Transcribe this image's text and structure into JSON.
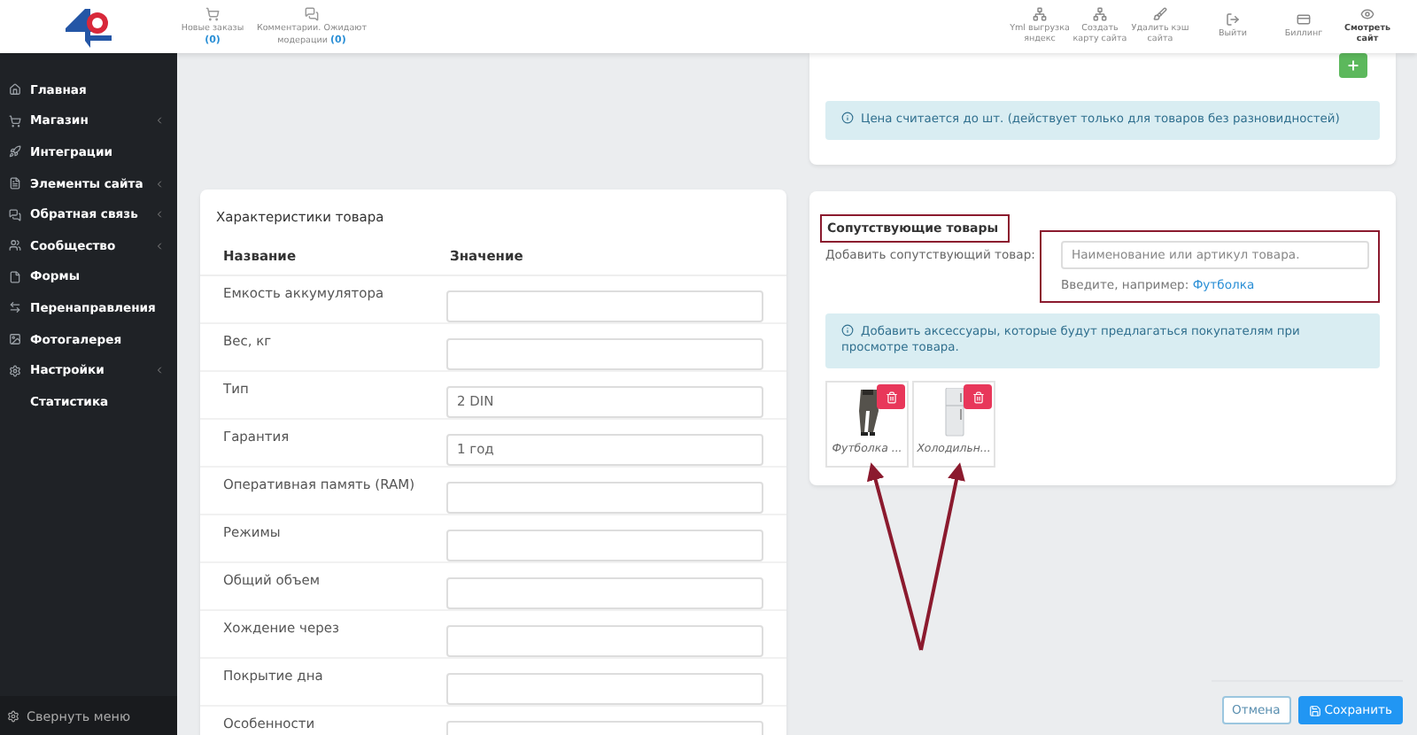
{
  "header": {
    "left_items": [
      {
        "label": "Новые заказы",
        "count": "(0)"
      },
      {
        "label": "Комментарии. Ожидают модерации",
        "count": "(0)"
      }
    ],
    "right_items": [
      {
        "label": "Yml выгрузка яндекс"
      },
      {
        "label": "Создать карту сайта"
      },
      {
        "label": "Удалить кэш сайта"
      },
      {
        "label": "Выйти"
      },
      {
        "label": "Биллинг"
      },
      {
        "label": "Смотреть сайт"
      }
    ]
  },
  "sidebar": {
    "items": [
      {
        "label": "Главная",
        "expandable": false
      },
      {
        "label": "Магазин",
        "expandable": true
      },
      {
        "label": "Интеграции",
        "expandable": false
      },
      {
        "label": "Элементы сайта",
        "expandable": true
      },
      {
        "label": "Обратная связь",
        "expandable": true
      },
      {
        "label": "Сообщество",
        "expandable": true
      },
      {
        "label": "Формы",
        "expandable": false
      },
      {
        "label": "Перенаправления",
        "expandable": false
      },
      {
        "label": "Фотогалерея",
        "expandable": false
      },
      {
        "label": "Настройки",
        "expandable": true
      },
      {
        "label": "Статистика",
        "expandable": false
      }
    ],
    "collapse": "Свернуть меню"
  },
  "characteristics": {
    "title": "Характеристики товара",
    "columns": [
      "Название",
      "Значение"
    ],
    "rows": [
      {
        "name": "Емкость аккумулятора",
        "value": ""
      },
      {
        "name": "Вес, кг",
        "value": ""
      },
      {
        "name": "Тип",
        "value": "2 DIN"
      },
      {
        "name": "Гарантия",
        "value": "1 год"
      },
      {
        "name": "Оперативная память (RAM)",
        "value": ""
      },
      {
        "name": "Режимы",
        "value": ""
      },
      {
        "name": "Общий объем",
        "value": ""
      },
      {
        "name": "Хождение через",
        "value": ""
      },
      {
        "name": "Покрытие дна",
        "value": ""
      },
      {
        "name": "Особенности",
        "value": ""
      }
    ]
  },
  "price_card": {
    "note": "Цена считается до шт. (действует только для товаров без разновидностей)"
  },
  "related": {
    "title": "Сопутствующие товары",
    "add_label": "Добавить сопутствующий товар:",
    "placeholder": "Наименование или артикул товара.",
    "hint": "Введите, например:",
    "hint_link": "Футболка",
    "note": "Добавить аксессуары, которые будут предлагаться покупателям при просмотре товара.",
    "products": [
      {
        "kind": "trousers",
        "caption": "Футболка ..."
      },
      {
        "kind": "fridge",
        "caption": "Холодильн..."
      }
    ]
  },
  "footer": {
    "cancel": "Отмена",
    "save": "Сохранить"
  }
}
